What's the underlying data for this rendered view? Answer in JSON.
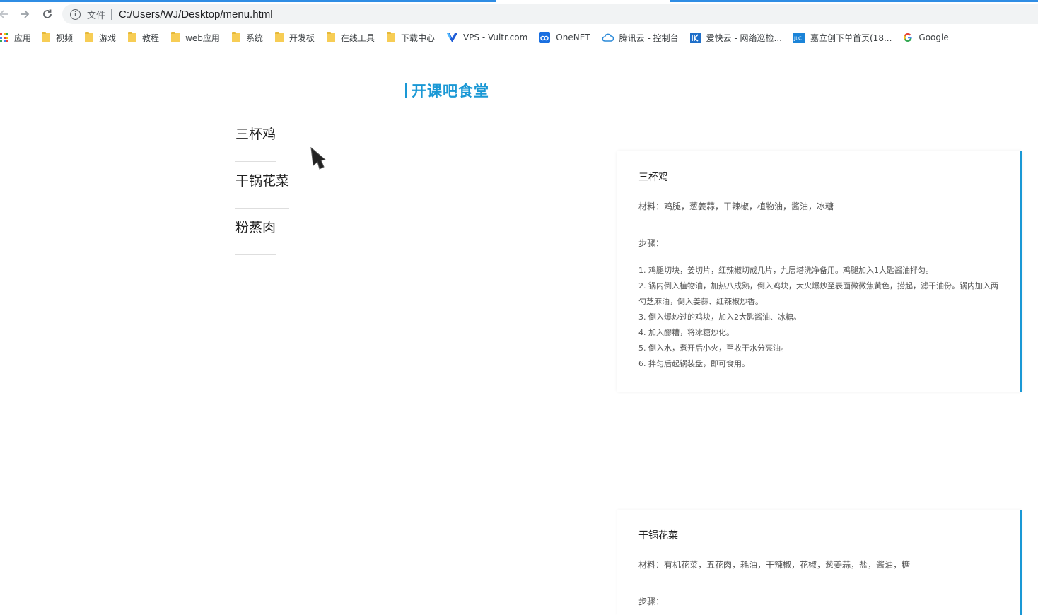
{
  "browser": {
    "address_scheme": "文件",
    "address_url": "C:/Users/WJ/Desktop/menu.html",
    "bookmarks": [
      {
        "label": "应用",
        "icon": "apps-grid-icon"
      },
      {
        "label": "视频",
        "icon": "folder-icon"
      },
      {
        "label": "游戏",
        "icon": "folder-icon"
      },
      {
        "label": "教程",
        "icon": "folder-icon"
      },
      {
        "label": "web应用",
        "icon": "folder-icon"
      },
      {
        "label": "系统",
        "icon": "folder-icon"
      },
      {
        "label": "开发板",
        "icon": "folder-icon"
      },
      {
        "label": "在线工具",
        "icon": "folder-icon"
      },
      {
        "label": "下载中心",
        "icon": "folder-icon"
      },
      {
        "label": "VPS - Vultr.com",
        "icon": "vultr-icon"
      },
      {
        "label": "OneNET",
        "icon": "onenet-icon"
      },
      {
        "label": "腾讯云 - 控制台",
        "icon": "tencent-cloud-icon"
      },
      {
        "label": "爱快云 - 网络巡检...",
        "icon": "ikuai-icon"
      },
      {
        "label": "嘉立创下单首页(18...",
        "icon": "jlc-icon"
      },
      {
        "label": "Google",
        "icon": "google-icon"
      }
    ]
  },
  "page": {
    "title": "开课吧食堂",
    "menu": [
      "三杯鸡",
      "干锅花菜",
      "粉蒸肉"
    ],
    "recipes": [
      {
        "name": "三杯鸡",
        "materials": "材料：鸡腿，葱姜蒜，干辣椒，植物油，酱油，冰糖",
        "steps_label": "步骤：",
        "steps": [
          "1. 鸡腿切块，姜切片，红辣椒切成几片，九层塔洗净备用。鸡腿加入1大匙酱油拌匀。",
          "2. 锅内倒入植物油，加热八成熟，倒入鸡块，大火爆炒至表面微微焦黄色，捞起，滤干油份。锅内加入两勺芝麻油，倒入姜蒜、红辣椒炒香。",
          "3. 倒入爆炒过的鸡块，加入2大匙酱油、冰糖。",
          "4. 加入醪糟，将冰糖炒化。",
          "5. 倒入水，煮开后小火，至收干水分亮油。",
          "6. 拌匀后起锅装盘，即可食用。"
        ]
      },
      {
        "name": "干锅花菜",
        "materials": "材料：有机花菜，五花肉，耗油，干辣椒，花椒，葱姜蒜，盐，酱油，糖",
        "steps_label": "步骤："
      }
    ]
  },
  "colors": {
    "accent": "#1a98d5",
    "tab_progress": "#2f8de4"
  }
}
